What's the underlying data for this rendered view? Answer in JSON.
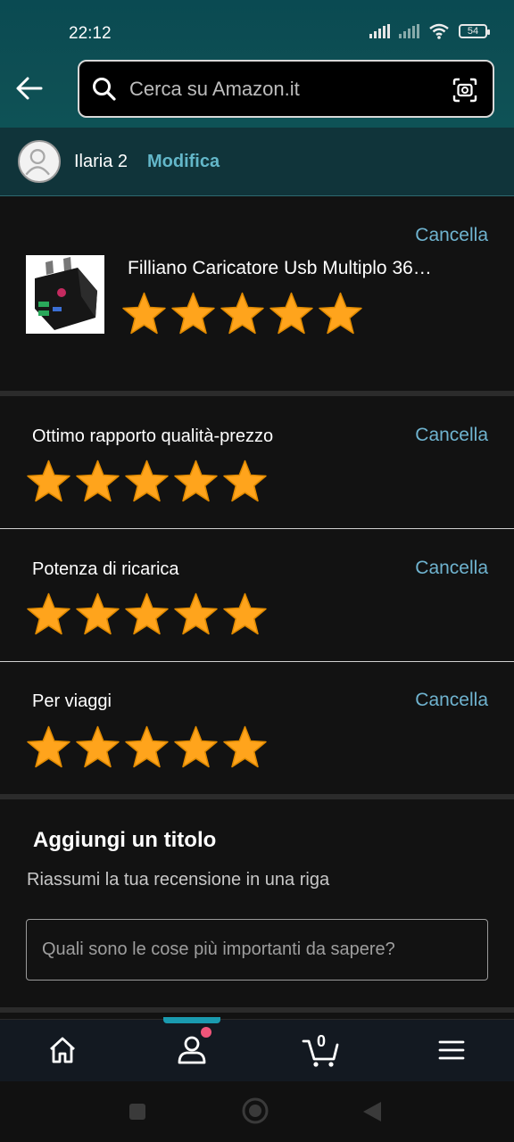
{
  "status": {
    "time": "22:12",
    "battery": "54"
  },
  "search": {
    "placeholder": "Cerca su Amazon.it"
  },
  "user": {
    "name": "Ilaria 2",
    "edit_label": "Modifica"
  },
  "product": {
    "title": "Filliano Caricatore Usb Multiplo 36…",
    "rating": 5,
    "cancel_label": "Cancella"
  },
  "attributes": [
    {
      "label": "Ottimo rapporto qualità-prezzo",
      "rating": 5,
      "cancel_label": "Cancella"
    },
    {
      "label": "Potenza di ricarica",
      "rating": 5,
      "cancel_label": "Cancella"
    },
    {
      "label": "Per viaggi",
      "rating": 5,
      "cancel_label": "Cancella"
    }
  ],
  "title_section": {
    "heading": "Aggiungi un titolo",
    "subheading": "Riassumi la tua recensione in una riga",
    "placeholder": "Quali sono le cose più importanti da sapere?"
  },
  "bottom_nav": {
    "cart_count": "0"
  },
  "colors": {
    "accent": "#63b7c9",
    "star": "#ffa41c",
    "header": "#0e4f54"
  },
  "icons": [
    "back-arrow-icon",
    "search-icon",
    "camera-icon",
    "avatar-icon",
    "home-icon",
    "profile-icon",
    "cart-icon",
    "menu-icon"
  ]
}
